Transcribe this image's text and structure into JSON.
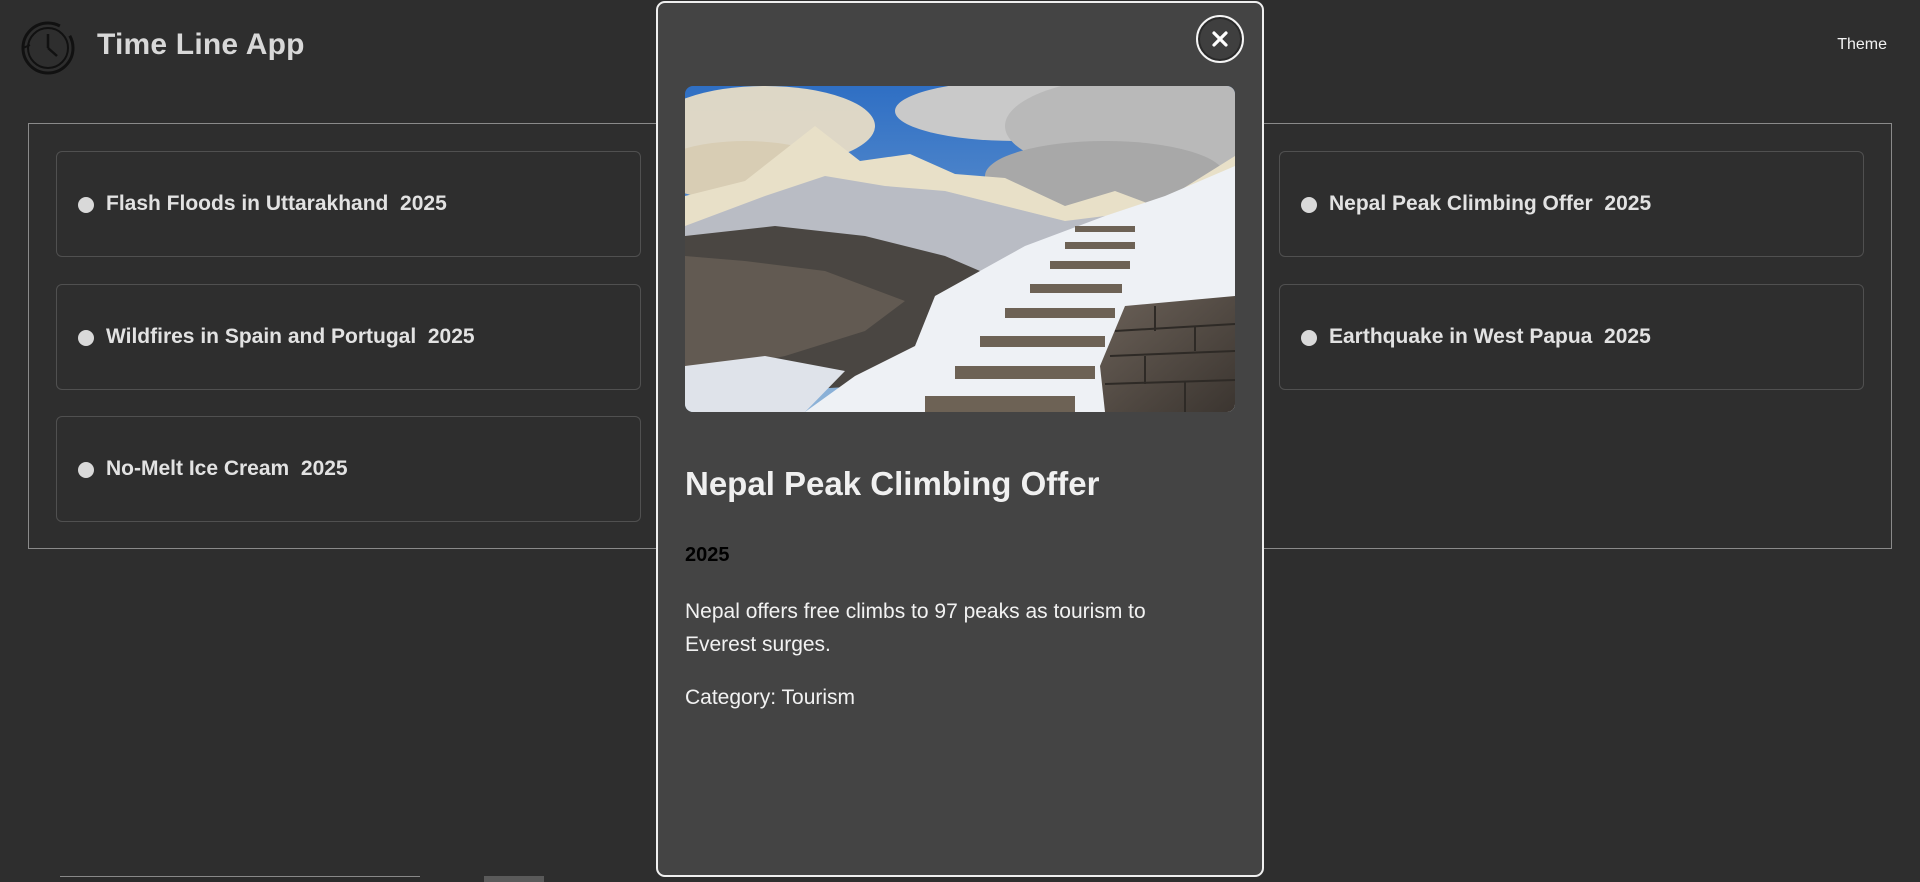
{
  "app": {
    "title": "Time Line App",
    "theme_label": "Theme"
  },
  "events": [
    {
      "title": "Flash Floods in Uttarakhand",
      "year": "2025"
    },
    {
      "title": "Wildfires in Spain and Portugal",
      "year": "2025"
    },
    {
      "title": "No-Melt Ice Cream",
      "year": "2025"
    },
    {
      "title": "Nepal Peak Climbing Offer",
      "year": "2025"
    },
    {
      "title": "Earthquake in West Papua",
      "year": "2025"
    }
  ],
  "modal": {
    "title": "Nepal Peak Climbing Offer",
    "year": "2025",
    "description": "Nepal offers free climbs to 97 peaks as tourism to Everest surges.",
    "category_label": "Category:",
    "category": "Tourism",
    "image_subject": "snowy mountain stone stairway"
  },
  "colors": {
    "background": "#2e2e2e",
    "modal_background": "#444444",
    "text": "#e6e6e6"
  }
}
